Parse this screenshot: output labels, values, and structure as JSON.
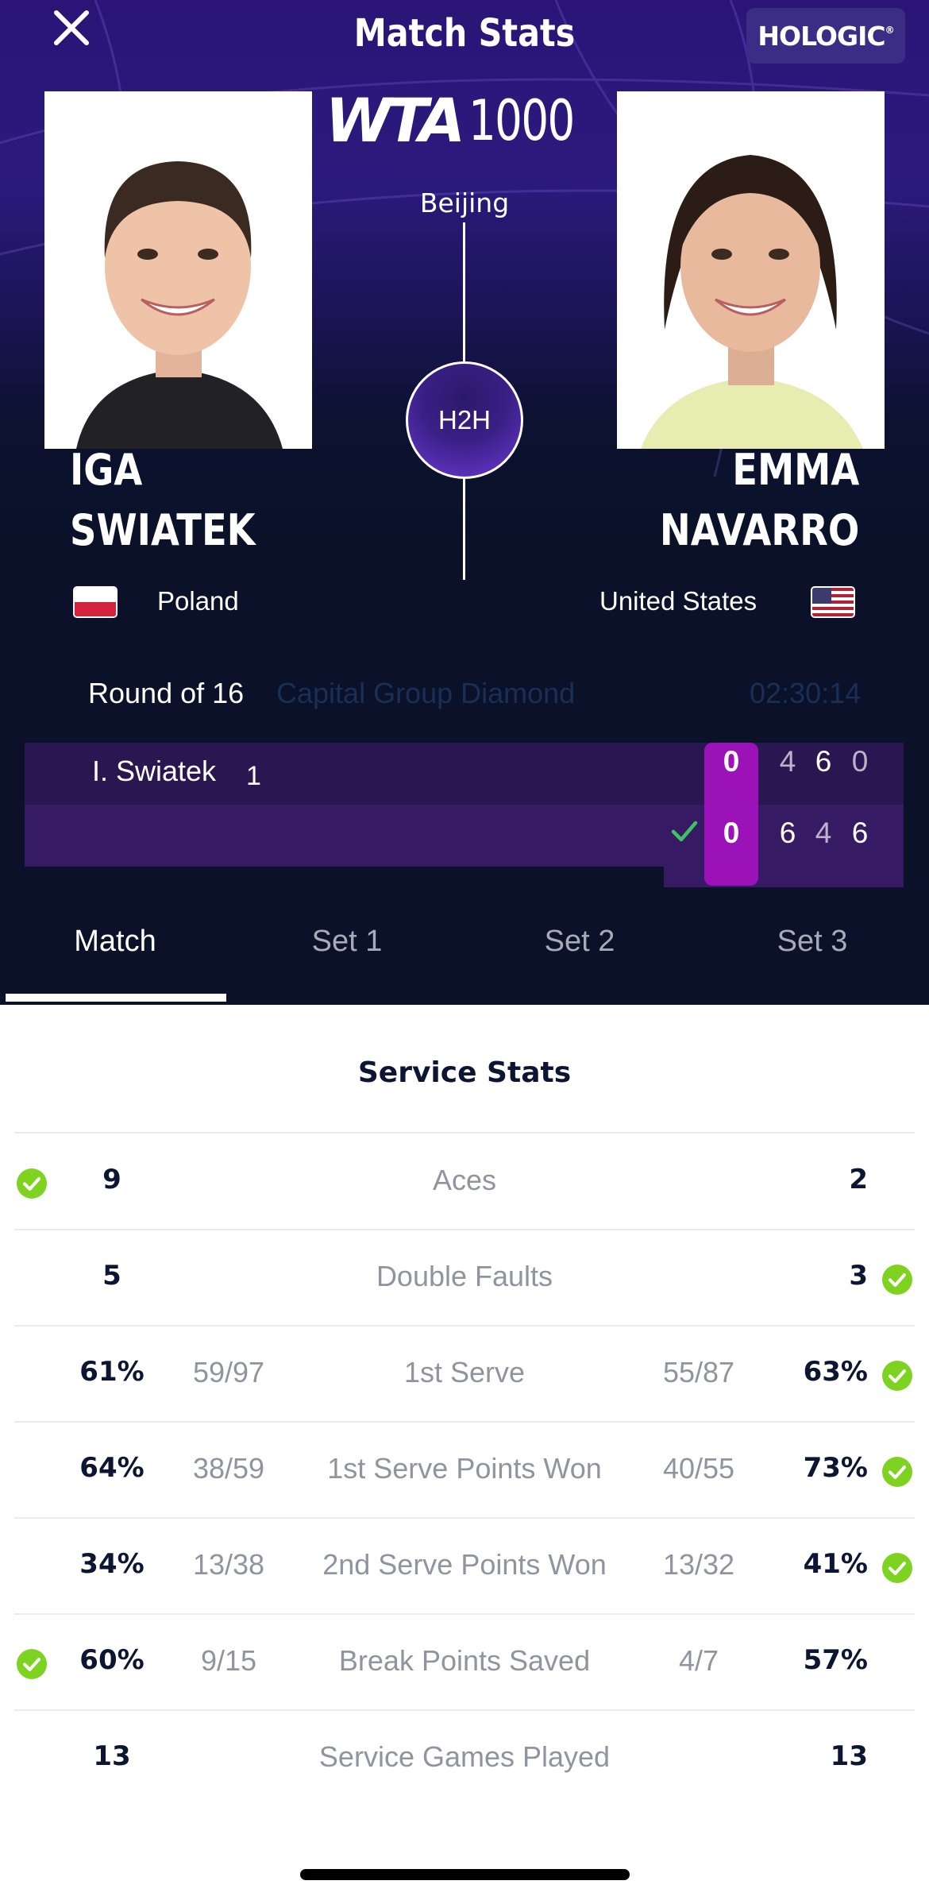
{
  "header": {
    "title": "Match Stats",
    "sponsor": "HOLOGIC",
    "sponsor_mark": "®",
    "tour_brand": "WTA",
    "tour_level": "1000",
    "city": "Beijing",
    "h2h_label": "H2H"
  },
  "players": [
    {
      "first": "IGA",
      "last": "SWIATEK",
      "country": "Poland",
      "short": "I. Swiatek",
      "seed": "1"
    },
    {
      "first": "EMMA",
      "last": "NAVARRO",
      "country": "United States",
      "short": ""
    }
  ],
  "match": {
    "round": "Round of 16",
    "court": "Capital Group Diamond",
    "duration": "02:30:14",
    "scores": [
      {
        "current": "0",
        "sets": [
          "4",
          "6",
          "0"
        ]
      },
      {
        "current": "0",
        "sets": [
          "6",
          "4",
          "6"
        ]
      }
    ]
  },
  "tabs": [
    "Match",
    "Set 1",
    "Set 2",
    "Set 3"
  ],
  "active_tab": "Match",
  "colors": {
    "accent": "#9b12b8",
    "win_check": "#7ed321"
  },
  "stats": {
    "section_title": "Service Stats",
    "rows": [
      {
        "label": "Aces",
        "left": "9",
        "left_frac": "",
        "right": "2",
        "right_frac": "",
        "winner": "left"
      },
      {
        "label": "Double Faults",
        "left": "5",
        "left_frac": "",
        "right": "3",
        "right_frac": "",
        "winner": "right"
      },
      {
        "label": "1st Serve",
        "left": "61%",
        "left_frac": "59/97",
        "right": "63%",
        "right_frac": "55/87",
        "winner": "right"
      },
      {
        "label": "1st Serve Points Won",
        "left": "64%",
        "left_frac": "38/59",
        "right": "73%",
        "right_frac": "40/55",
        "winner": "right"
      },
      {
        "label": "2nd Serve Points Won",
        "left": "34%",
        "left_frac": "13/38",
        "right": "41%",
        "right_frac": "13/32",
        "winner": "right"
      },
      {
        "label": "Break Points Saved",
        "left": "60%",
        "left_frac": "9/15",
        "right": "57%",
        "right_frac": "4/7",
        "winner": "left"
      },
      {
        "label": "Service Games Played",
        "left": "13",
        "left_frac": "",
        "right": "13",
        "right_frac": "",
        "winner": ""
      }
    ]
  }
}
